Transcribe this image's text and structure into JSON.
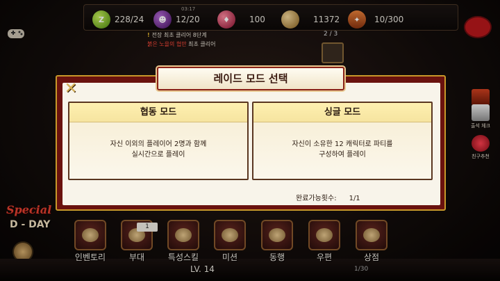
{
  "resources": {
    "stamina": {
      "icon": "stamina-icon",
      "value": "228/24"
    },
    "ticket": {
      "icon": "ticket-icon",
      "value": "12/20",
      "timer": "03:17"
    },
    "gem": {
      "icon": "gem-icon",
      "value": "100"
    },
    "gold": {
      "icon": "gold-icon",
      "value": "11372"
    },
    "medal": {
      "icon": "medal-icon",
      "value": "10/300"
    }
  },
  "news": {
    "line1_prefix": "!",
    "line1": "전장 최초 클리어 8단계",
    "line2_red": "붉은 노을의 협만",
    "line2_rest": " 최초 클리어",
    "pager": "2 / 3"
  },
  "side_menu": [
    {
      "icon": "book-icon",
      "label": "도감"
    },
    {
      "icon": "attendance-icon",
      "label": "출석 체크"
    },
    {
      "icon": "heart-icon",
      "label": "친구추천"
    }
  ],
  "event": {
    "special": "Special",
    "dday": "D - DAY"
  },
  "bottom_menu": [
    {
      "label": "인벤토리"
    },
    {
      "label": "부대",
      "badge": "1"
    },
    {
      "label": "특성스킬"
    },
    {
      "label": "미션"
    },
    {
      "label": "동행"
    },
    {
      "label": "우편"
    },
    {
      "label": "상점"
    }
  ],
  "player": {
    "level": "LV. 14",
    "page": "1/30"
  },
  "modal": {
    "title": "레이드 모드 선택",
    "close_icon": "close-icon",
    "modes": [
      {
        "title": "협동 모드",
        "desc1": "자신 이외의 플레이어 2명과 함께",
        "desc2": "실시간으로 플레이"
      },
      {
        "title": "싱글 모드",
        "desc1": "자신이 소유한 12 캐릭터로 파티를",
        "desc2": "구성하여 플레이"
      }
    ],
    "completion_label": "완료가능횟수:",
    "completion_value": "1/1"
  },
  "colors": {
    "accent_gold": "#c8982a",
    "frame_red": "#6a120e",
    "card_bg": "#fdf3cc"
  }
}
